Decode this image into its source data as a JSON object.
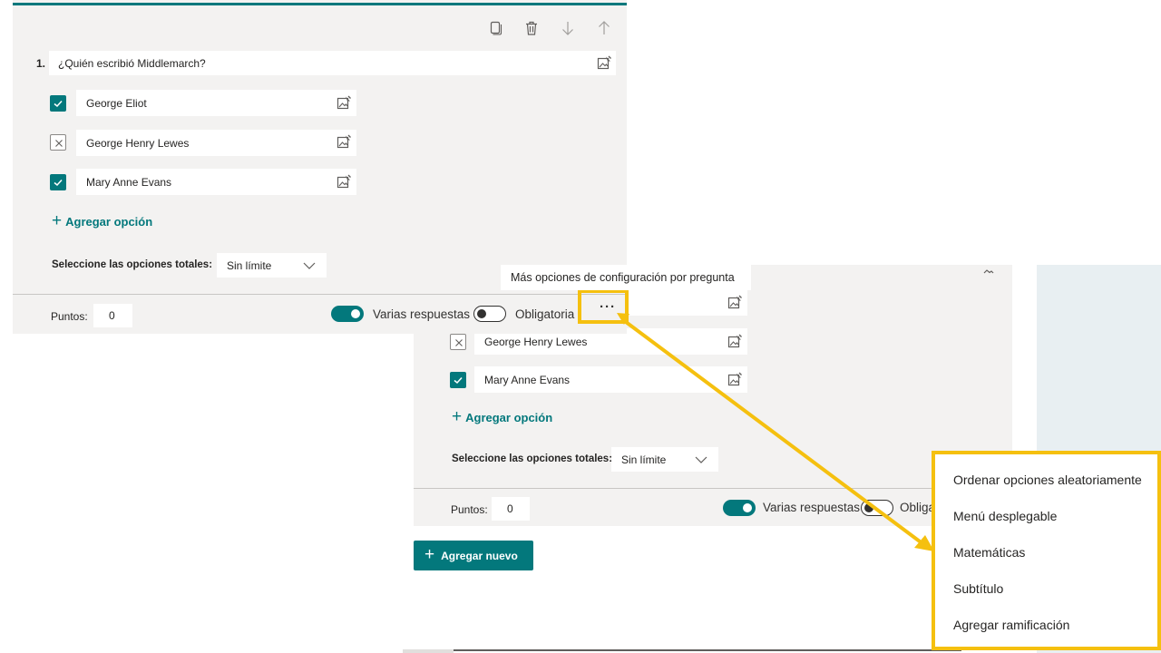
{
  "front": {
    "question_number": "1.",
    "question_text": "¿Quién escribió Middlemarch?",
    "options": [
      {
        "label": "George Eliot",
        "correct": true
      },
      {
        "label": "George Henry Lewes",
        "correct": false
      },
      {
        "label": "Mary Anne Evans",
        "correct": true
      }
    ],
    "add_option": "Agregar opción",
    "total_options_label": "Seleccione las opciones totales:",
    "total_options_value": "Sin límite",
    "points_label": "Puntos:",
    "points_value": "0",
    "multiple_answers_label": "Varias respuestas",
    "required_label": "Obligatoria",
    "more_dots": "···"
  },
  "back": {
    "options": [
      {
        "label": "George Henry Lewes",
        "correct": false
      },
      {
        "label": "Mary Anne Evans",
        "correct": true
      }
    ],
    "add_option": "Agregar opción",
    "total_options_label": "Seleccione las opciones totales:",
    "total_options_value": "Sin límite",
    "points_label": "Puntos:",
    "points_value": "0",
    "multiple_answers_label": "Varias respuestas",
    "required_label_partial": "Obliga",
    "add_new": "Agregar nuevo"
  },
  "callout": "Más opciones de configuración por pregunta",
  "menu": {
    "items": [
      "Ordenar opciones aleatoriamente",
      "Menú desplegable",
      "Matemáticas",
      "Subtítulo",
      "Agregar ramificación"
    ]
  },
  "colors": {
    "accent": "#03787c",
    "highlight": "#f5c00f",
    "card_bg": "#f3f2f1"
  }
}
